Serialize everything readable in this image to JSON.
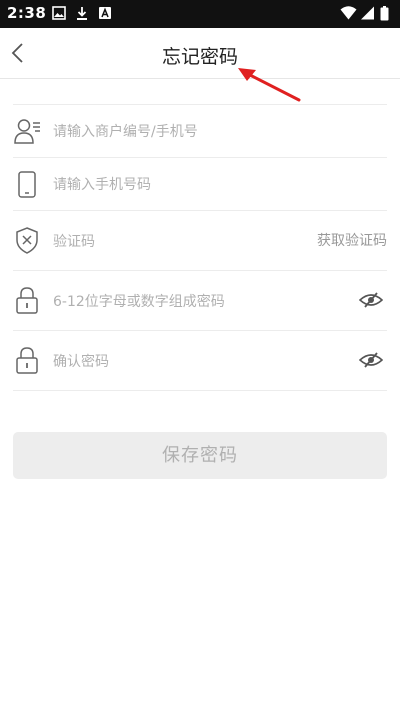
{
  "status_bar": {
    "time": "2:38",
    "left_icons": [
      "image-icon",
      "download-icon",
      "app-notification-icon"
    ],
    "right_icons": [
      "wifi-icon",
      "signal-icon",
      "battery-icon"
    ]
  },
  "nav": {
    "title": "忘记密码",
    "back_icon": "chevron-left-icon"
  },
  "annotation": {
    "arrow_color": "#e02020"
  },
  "form": {
    "account": {
      "placeholder": "请输入商户编号/手机号",
      "icon": "user-icon"
    },
    "phone": {
      "placeholder": "请输入手机号码",
      "icon": "phone-icon"
    },
    "code": {
      "placeholder": "验证码",
      "icon": "shield-x-icon",
      "action": "获取验证码"
    },
    "password": {
      "placeholder": "6-12位字母或数字组成密码",
      "icon": "lock-icon",
      "toggle_icon": "eye-hidden-icon"
    },
    "confirm": {
      "placeholder": "确认密码",
      "icon": "lock-icon",
      "toggle_icon": "eye-hidden-icon"
    }
  },
  "save_button": {
    "label": "保存密码",
    "enabled": false
  }
}
